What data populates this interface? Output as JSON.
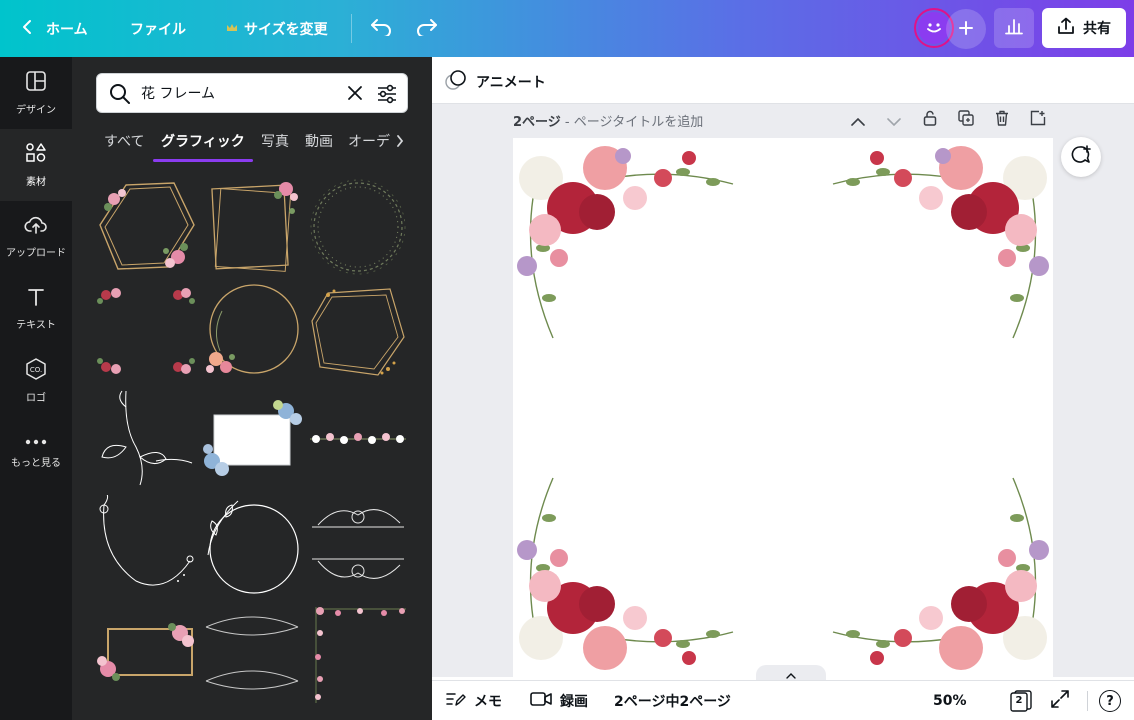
{
  "topbar": {
    "home_label": "ホーム",
    "file_label": "ファイル",
    "resize_label": "サイズを変更",
    "share_label": "共有",
    "icons": [
      "chevron-left-icon",
      "crown-icon",
      "undo-icon",
      "redo-icon",
      "smiley-avatar-icon",
      "plus-icon",
      "bar-chart-icon",
      "share-upload-icon"
    ]
  },
  "rail": {
    "items": [
      {
        "label": "デザイン",
        "icon": "layout-icon"
      },
      {
        "label": "素材",
        "icon": "shapes-icon"
      },
      {
        "label": "アップロード",
        "icon": "cloud-upload-icon"
      },
      {
        "label": "テキスト",
        "icon": "text-t-icon"
      },
      {
        "label": "ロゴ",
        "icon": "logo-co-icon"
      },
      {
        "label": "もっと見る",
        "icon": "more-dots-icon"
      }
    ],
    "active": "素材"
  },
  "panel": {
    "search_value": "花 フレーム",
    "tabs": [
      "すべて",
      "グラフィック",
      "写真",
      "動画",
      "オーデ"
    ],
    "active_tab": "グラフィック"
  },
  "editor": {
    "animate_label": "アニメート",
    "page_label": "2ページ",
    "page_title_placeholder": "ページタイトルを追加",
    "page_separator": " - "
  },
  "bottombar": {
    "notes_label": "メモ",
    "record_label": "録画",
    "page_count": "2ページ中2ページ",
    "zoom": "50%",
    "page_badge": "2",
    "help": "?"
  },
  "colors": {
    "gradient_start": "#00c4cc",
    "gradient_end": "#7d3ee8",
    "accent_purple": "#8b3cf0",
    "panel_bg": "#252627",
    "rail_bg": "#18191b",
    "avatar_ring": "#e0118a"
  }
}
